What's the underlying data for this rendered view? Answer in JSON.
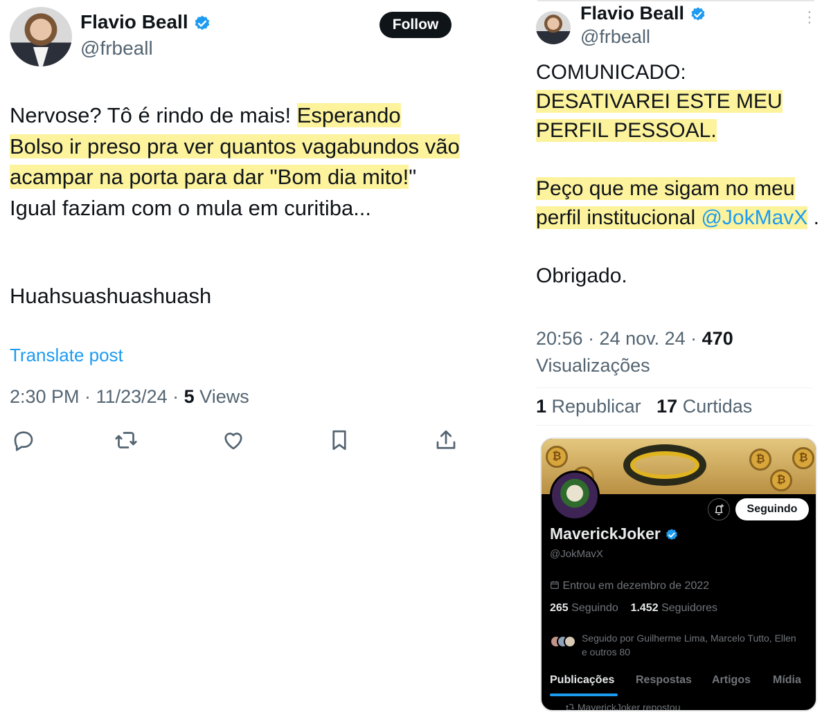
{
  "left_tweet": {
    "name": "Flavio Beall",
    "handle": "@frbeall",
    "follow_label": "Follow",
    "body_plain": "Nervose? Tô é rindo de mais! ",
    "body_highlight_1": "Esperando Bolso ir preso pra ver quantos vagabundos vão acampar na porta para dar \"Bom dia mito!",
    "body_after": "\" Igual faziam com o mula em curitiba...",
    "body_laugh": "Huahsuashuashuash",
    "translate_label": "Translate post",
    "time": "2:30 PM · 11/23/24 · ",
    "views_count": "5",
    "views_label": " Views",
    "actions": [
      "reply-icon",
      "repost-icon",
      "like-icon",
      "bookmark-icon",
      "share-icon"
    ]
  },
  "right_tweet": {
    "name": "Flavio Beall",
    "handle": "@frbeall",
    "more": "⋮",
    "line_1": "COMUNICADO:",
    "line_2_highlight": "DESATIVAREI ESTE MEU PERFIL PESSOAL.",
    "line_3_highlight": "Peço que me sigam no meu perfil institucional ",
    "mention": "@JokMavX",
    "line_3_end": " .",
    "line_4": "Obrigado.",
    "time": "20:56 · 24 nov. 24 · ",
    "views_count": "470",
    "views_label": "Visualizações",
    "reposts_count": "1",
    "reposts_label": "Republicar",
    "likes_count": "17",
    "likes_label": "Curtidas"
  },
  "profile_card": {
    "seguindo_label": "Seguindo",
    "name": "MaverickJoker",
    "handle": "@JokMavX",
    "joined": "Entrou em dezembro de 2022",
    "following_count": "265",
    "following_label": "Seguindo",
    "followers_count": "1.452",
    "followers_label": "Seguidores",
    "followed_by": "Seguido por Guilherme Lima, Marcelo Tutto, Ellen e outros 80",
    "tabs": [
      "Publicações",
      "Respostas",
      "Artigos",
      "Mídia"
    ],
    "reposted": "MaverickJoker repostou"
  },
  "colors": {
    "highlight": "#fdf39d",
    "link": "#1d9bf0",
    "verified": "#1d9bf0",
    "muted": "#536471"
  }
}
